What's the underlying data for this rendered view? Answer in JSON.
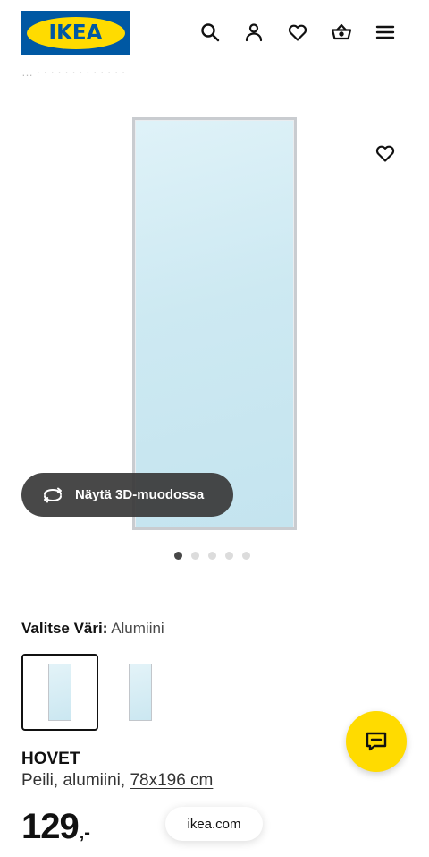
{
  "header": {
    "logo_text": "IKEA",
    "icons": [
      "search-icon",
      "account-icon",
      "favourites-icon",
      "basket-icon",
      "menu-icon"
    ]
  },
  "breadcrumb_partial": "… · · · · · · · · · · · · ·",
  "gallery": {
    "button_3d_label": "Näytä 3D-muodossa",
    "slide_count": 5,
    "active_slide": 1
  },
  "color": {
    "label": "Valitse Väri:",
    "value": "Alumiini"
  },
  "product": {
    "name": "HOVET",
    "description": "Peili, alumiini,",
    "dimensions": "78x196 cm",
    "price_integer": "129",
    "price_suffix": ",-"
  },
  "browser": {
    "url": "ikea.com"
  },
  "colors": {
    "brand_blue": "#0058a3",
    "brand_yellow": "#ffdb00",
    "pill_dark": "#383838"
  }
}
